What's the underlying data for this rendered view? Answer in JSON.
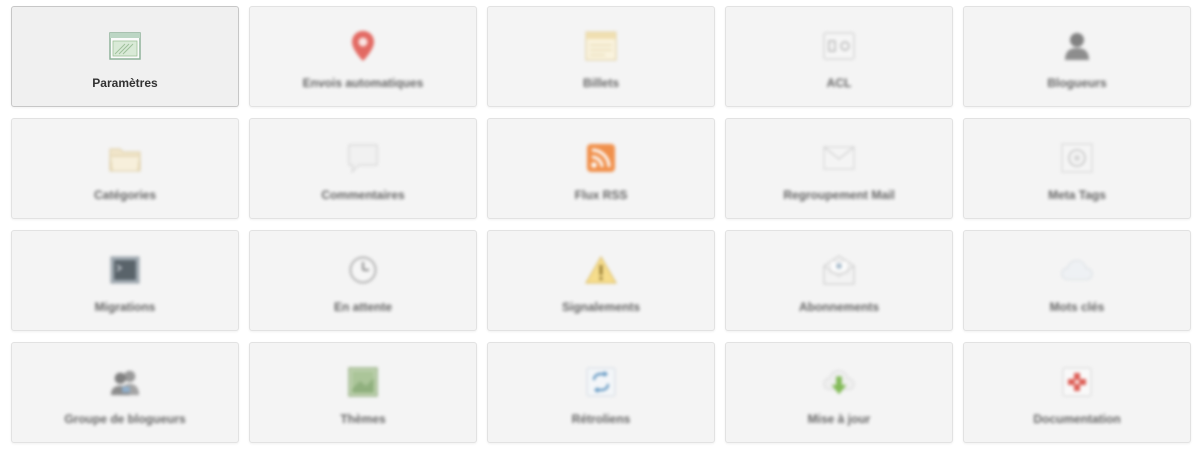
{
  "tiles": [
    {
      "id": "parametres",
      "label": "Paramètres",
      "icon": "settings-window-icon",
      "active": true
    },
    {
      "id": "envois-automatiques",
      "label": "Envois automatiques",
      "icon": "map-pin-icon",
      "color": "#e0524a"
    },
    {
      "id": "billets",
      "label": "Billets",
      "icon": "post-page-icon"
    },
    {
      "id": "acl",
      "label": "ACL",
      "icon": "acl-icon"
    },
    {
      "id": "blogueurs",
      "label": "Blogueurs",
      "icon": "user-icon"
    },
    {
      "id": "categories",
      "label": "Catégories",
      "icon": "folder-icon"
    },
    {
      "id": "commentaires",
      "label": "Commentaires",
      "icon": "comment-bubble-icon"
    },
    {
      "id": "flux-rss",
      "label": "Flux RSS",
      "icon": "rss-icon",
      "color": "#f07f2e"
    },
    {
      "id": "regroupement-mail",
      "label": "Regroupement Mail",
      "icon": "envelope-icon"
    },
    {
      "id": "meta-tags",
      "label": "Meta Tags",
      "icon": "tag-icon"
    },
    {
      "id": "migrations",
      "label": "Migrations",
      "icon": "terminal-icon"
    },
    {
      "id": "en-attente",
      "label": "En attente",
      "icon": "clock-icon"
    },
    {
      "id": "signalements",
      "label": "Signalements",
      "icon": "warning-icon",
      "color": "#f2c430"
    },
    {
      "id": "abonnements",
      "label": "Abonnements",
      "icon": "subscription-mail-icon"
    },
    {
      "id": "mots-cles",
      "label": "Mots clés",
      "icon": "cloud-icon"
    },
    {
      "id": "groupe-de-blogueurs",
      "label": "Groupe de blogueurs",
      "icon": "user-group-icon"
    },
    {
      "id": "themes",
      "label": "Thèmes",
      "icon": "theme-image-icon",
      "color": "#7fa56a"
    },
    {
      "id": "retroliens",
      "label": "Rétroliens",
      "icon": "refresh-arrows-icon",
      "color": "#3c7fb5"
    },
    {
      "id": "mise-a-jour",
      "label": "Mise à jour",
      "icon": "download-update-icon",
      "color": "#6fb13c"
    },
    {
      "id": "documentation",
      "label": "Documentation",
      "icon": "help-document-icon",
      "color": "#d9433a"
    }
  ]
}
